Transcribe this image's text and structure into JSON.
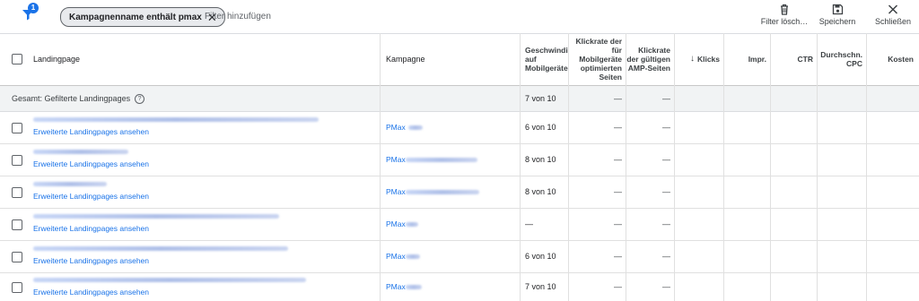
{
  "toolbar": {
    "filter_count": "1",
    "chip_label": "Kampagnenname enthält pmax",
    "add_filter": "Filter hinzufügen",
    "clear_label": "Filter lösch…",
    "save_label": "Speichern",
    "close_label": "Schließen"
  },
  "columns": {
    "landingpage": "Landingpage",
    "kampagne": "Kampagne",
    "speed": "Geschwindi auf Mobilgeräte",
    "ctr_mobile": "Klickrate der für Mobilgeräte optimierten Seiten",
    "ctr_amp": "Klickrate der gültigen AMP-Seiten",
    "klicks": "Klicks",
    "impr": "Impr.",
    "ctr": "CTR",
    "cpc": "Durchschn. CPC",
    "kosten": "Kosten"
  },
  "total": {
    "label": "Gesamt: Gefilterte Landingpages",
    "speed": "7 von 10",
    "ctr_mobile": "—",
    "ctr_amp": "—"
  },
  "rows": [
    {
      "link": "Erweiterte Landingpages ansehen",
      "campaign": "PMax",
      "speed": "6 von 10",
      "ctr_mobile": "—",
      "ctr_amp": "—"
    },
    {
      "link": "Erweiterte Landingpages ansehen",
      "campaign": "PMax",
      "speed": "8 von 10",
      "ctr_mobile": "—",
      "ctr_amp": "—"
    },
    {
      "link": "Erweiterte Landingpages ansehen",
      "campaign": "PMax",
      "speed": "8 von 10",
      "ctr_mobile": "—",
      "ctr_amp": "—"
    },
    {
      "link": "Erweiterte Landingpages ansehen",
      "campaign": "PMax",
      "speed": "—",
      "ctr_mobile": "—",
      "ctr_amp": "—"
    },
    {
      "link": "Erweiterte Landingpages ansehen",
      "campaign": "PMax",
      "speed": "6 von 10",
      "ctr_mobile": "—",
      "ctr_amp": "—"
    },
    {
      "link": "Erweiterte Landingpages ansehen",
      "campaign": "PMax",
      "speed": "7 von 10",
      "ctr_mobile": "—",
      "ctr_amp": "—"
    }
  ],
  "colors": {
    "accent": "#1a73e8",
    "header_bg": "#f1f3f4",
    "chip_bg": "#e8eaed"
  },
  "icons": [
    "filter-icon",
    "close-icon",
    "trash-icon",
    "save-icon",
    "arrow-down-icon",
    "help-icon"
  ]
}
